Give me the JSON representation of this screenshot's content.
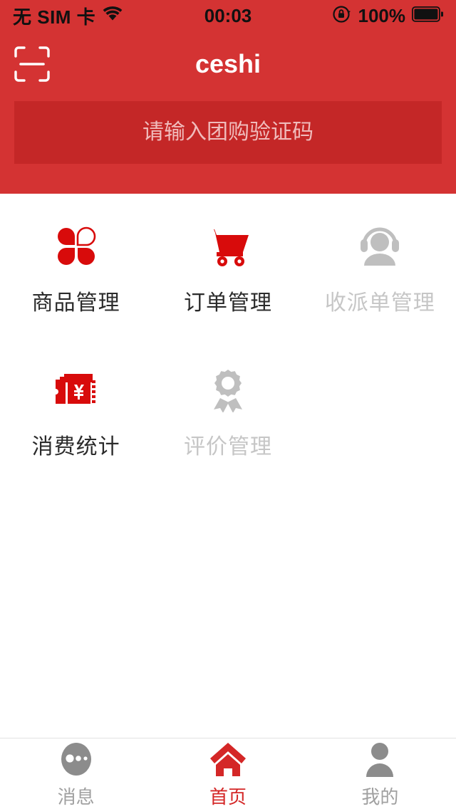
{
  "theme": {
    "header_red": "#d43333",
    "input_red": "#c42727",
    "accent_red": "#d42727",
    "disabled_gray": "#c6c6c6"
  },
  "status_bar": {
    "carrier": "无 SIM 卡",
    "wifi_icon": "wifi-icon",
    "time": "00:03",
    "rotation_lock_icon": "rotation-lock-icon",
    "battery_percent": "100%",
    "battery_icon": "battery-full-icon"
  },
  "header": {
    "scan_icon": "scan-qr-icon",
    "title": "ceshi"
  },
  "search": {
    "placeholder": "请输入团购验证码",
    "value": ""
  },
  "menu": {
    "items": [
      {
        "label": "商品管理",
        "icon": "clover-flower-icon",
        "enabled": true
      },
      {
        "label": "订单管理",
        "icon": "shopping-cart-icon",
        "enabled": true
      },
      {
        "label": "收派单管理",
        "icon": "headset-agent-icon",
        "enabled": false
      },
      {
        "label": "消费统计",
        "icon": "coupon-yuan-icon",
        "enabled": true
      },
      {
        "label": "评价管理",
        "icon": "award-medal-icon",
        "enabled": false
      }
    ]
  },
  "tabbar": {
    "items": [
      {
        "label": "消息",
        "icon": "message-dots-icon",
        "active": false
      },
      {
        "label": "首页",
        "icon": "home-icon",
        "active": true
      },
      {
        "label": "我的",
        "icon": "person-icon",
        "active": false
      }
    ]
  }
}
